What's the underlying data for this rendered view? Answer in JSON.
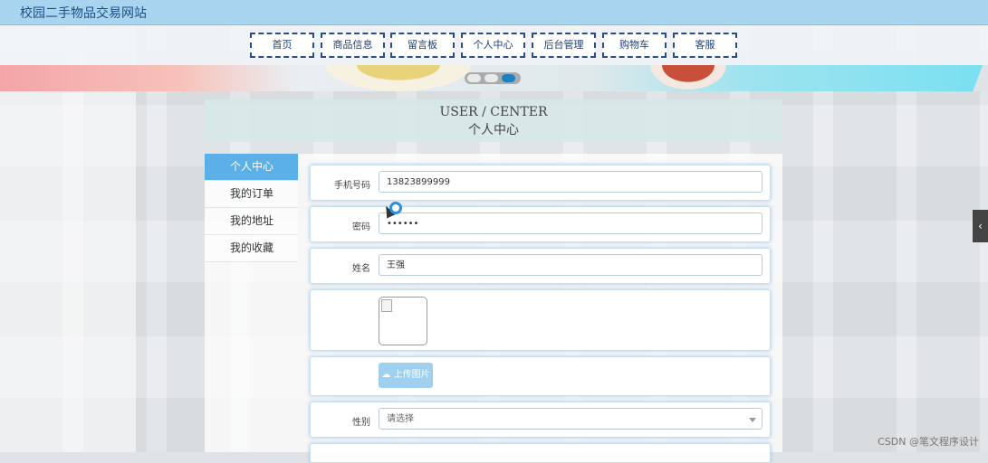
{
  "site": {
    "title": "校园二手物品交易网站"
  },
  "nav": {
    "items": [
      "首页",
      "商品信息",
      "留言板",
      "个人中心",
      "后台管理",
      "购物车",
      "客服"
    ]
  },
  "heading": {
    "en": "USER / CENTER",
    "cn": "个人中心"
  },
  "sidebar": {
    "items": [
      "个人中心",
      "我的订单",
      "我的地址",
      "我的收藏"
    ],
    "active_index": 0
  },
  "form": {
    "phone": {
      "label": "手机号码",
      "value": "13823899999"
    },
    "password": {
      "label": "密码",
      "value": "••••••"
    },
    "name": {
      "label": "姓名",
      "value": "王强"
    },
    "upload": {
      "label": "上传图片",
      "icon": "cloud-upload-icon"
    },
    "gender": {
      "label": "性别",
      "placeholder": "请选择"
    }
  },
  "slider": {
    "dots": 3,
    "active_index": 2
  },
  "side_toggle": {
    "symbol": "‹"
  },
  "watermark": "CSDN @笔文程序设计",
  "colors": {
    "nav_border": "#2c4d85",
    "active": "#5cb0e8",
    "upload_button": "#9fd0ef",
    "topbar": "#a9d4ef"
  }
}
